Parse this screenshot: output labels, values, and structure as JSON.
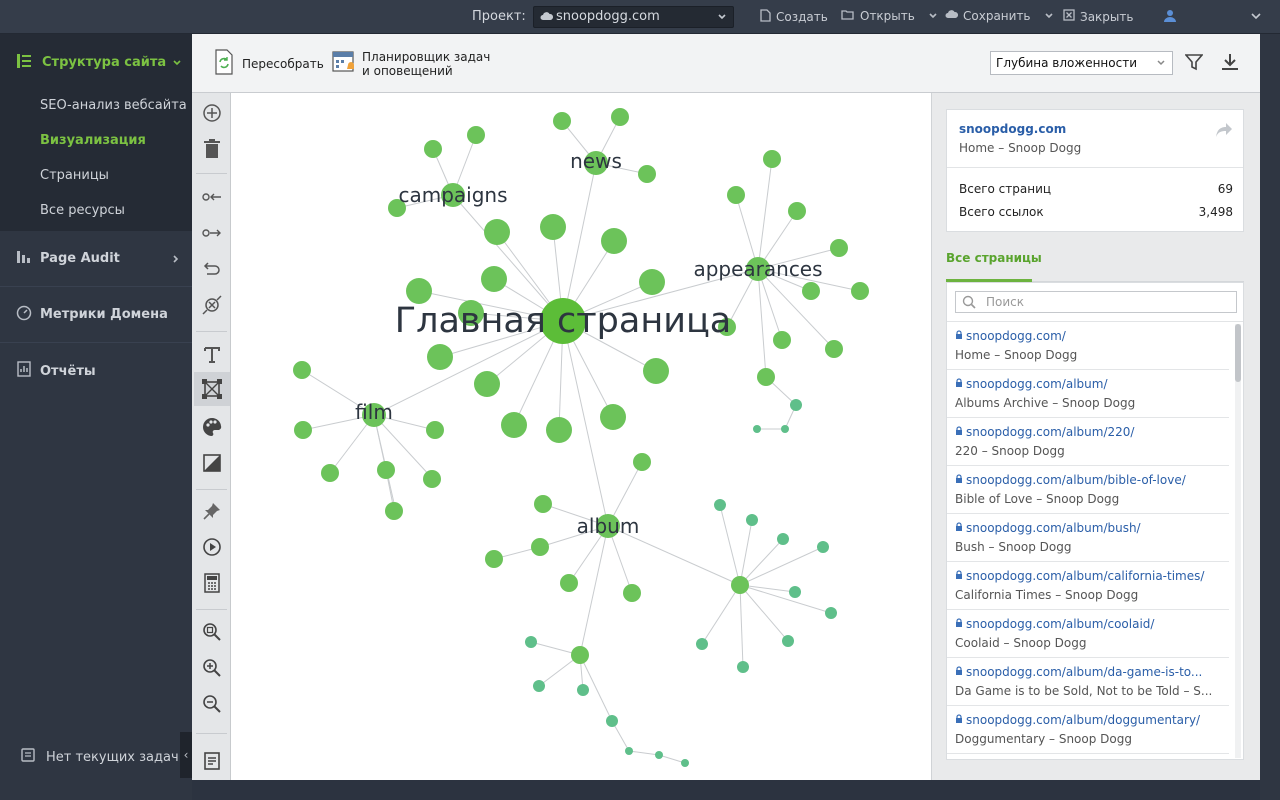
{
  "topbar": {
    "project_label": "Проект:",
    "project_value": "snoopdogg.com",
    "create_label": "Создать",
    "open_label": "Открыть",
    "save_label": "Сохранить",
    "close_label": "Закрыть"
  },
  "sidebar": {
    "main_label": "Структура сайта",
    "sub_items": [
      {
        "label": "SEO-анализ вебсайта",
        "active": false
      },
      {
        "label": "Визуализация",
        "active": true
      },
      {
        "label": "Страницы",
        "active": false
      },
      {
        "label": "Все ресурсы",
        "active": false
      }
    ],
    "items": [
      {
        "label": "Page Audit"
      },
      {
        "label": "Метрики Домена"
      },
      {
        "label": "Отчёты"
      }
    ],
    "footer_label": "Нет текущих задач"
  },
  "toolbar": {
    "rebuild_label": "Пересобрать",
    "scheduler_line1": "Планировщик задач",
    "scheduler_line2": "и оповещений",
    "depth_select": "Глубина вложенности"
  },
  "graph": {
    "labels": {
      "home": "Главная страница",
      "news": "news",
      "campaigns": "campaigns",
      "appearances": "appearances",
      "film": "film",
      "album": "album"
    }
  },
  "panel": {
    "domain": "snoopdogg.com",
    "site_title": "Home – Snoop Dogg",
    "total_pages_label": "Всего страниц",
    "total_pages_value": "69",
    "total_links_label": "Всего ссылок",
    "total_links_value": "3,498",
    "tab_label": "Все страницы",
    "search_placeholder": "Поиск",
    "pages": [
      {
        "url": "snoopdogg.com/",
        "title": "Home – Snoop Dogg"
      },
      {
        "url": "snoopdogg.com/album/",
        "title": "Albums Archive – Snoop Dogg"
      },
      {
        "url": "snoopdogg.com/album/220/",
        "title": "220 – Snoop Dogg"
      },
      {
        "url": "snoopdogg.com/album/bible-of-love/",
        "title": "Bible of Love – Snoop Dogg"
      },
      {
        "url": "snoopdogg.com/album/bush/",
        "title": "Bush – Snoop Dogg"
      },
      {
        "url": "snoopdogg.com/album/california-times/",
        "title": "California Times – Snoop Dogg"
      },
      {
        "url": "snoopdogg.com/album/coolaid/",
        "title": "Coolaid – Snoop Dogg"
      },
      {
        "url": "snoopdogg.com/album/da-game-is-to...",
        "title": "Da Game is to be Sold, Not to be Told – S..."
      },
      {
        "url": "snoopdogg.com/album/doggumentary/",
        "title": "Doggumentary – Snoop Dogg"
      }
    ]
  },
  "colors": {
    "accent": "#7cc242",
    "node": "#6cc35a",
    "node_small": "#5fbf8a",
    "link": "#2a5ea8"
  }
}
